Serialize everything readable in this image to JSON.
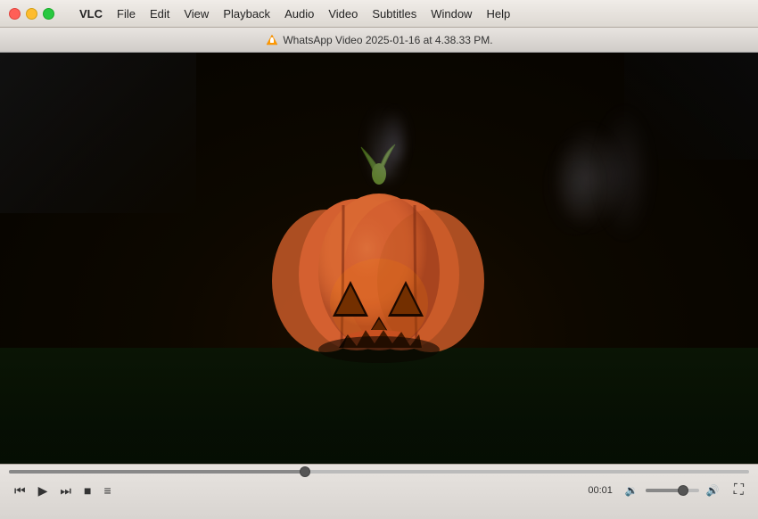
{
  "app": {
    "name": "VLC",
    "title": "WhatsApp Video 2025-01-16 at 4.38.33 PM."
  },
  "menu": {
    "apple_label": "",
    "items": [
      {
        "id": "vlc",
        "label": "VLC"
      },
      {
        "id": "file",
        "label": "File"
      },
      {
        "id": "edit",
        "label": "Edit"
      },
      {
        "id": "view",
        "label": "View"
      },
      {
        "id": "playback",
        "label": "Playback"
      },
      {
        "id": "audio",
        "label": "Audio"
      },
      {
        "id": "video",
        "label": "Video"
      },
      {
        "id": "subtitles",
        "label": "Subtitles"
      },
      {
        "id": "window",
        "label": "Window"
      },
      {
        "id": "help",
        "label": "Help"
      }
    ]
  },
  "controls": {
    "rewind_label": "⏮",
    "play_label": "▶",
    "fastforward_label": "⏭",
    "stop_label": "■",
    "playlist_label": "≡",
    "time_current": "00:01",
    "volume_icon": "🔉",
    "fullscreen_label": "⛶",
    "progress_percent": 40,
    "volume_percent": 70
  },
  "video": {
    "content": "Halloween pumpkin jack-o-lantern with smoke"
  }
}
